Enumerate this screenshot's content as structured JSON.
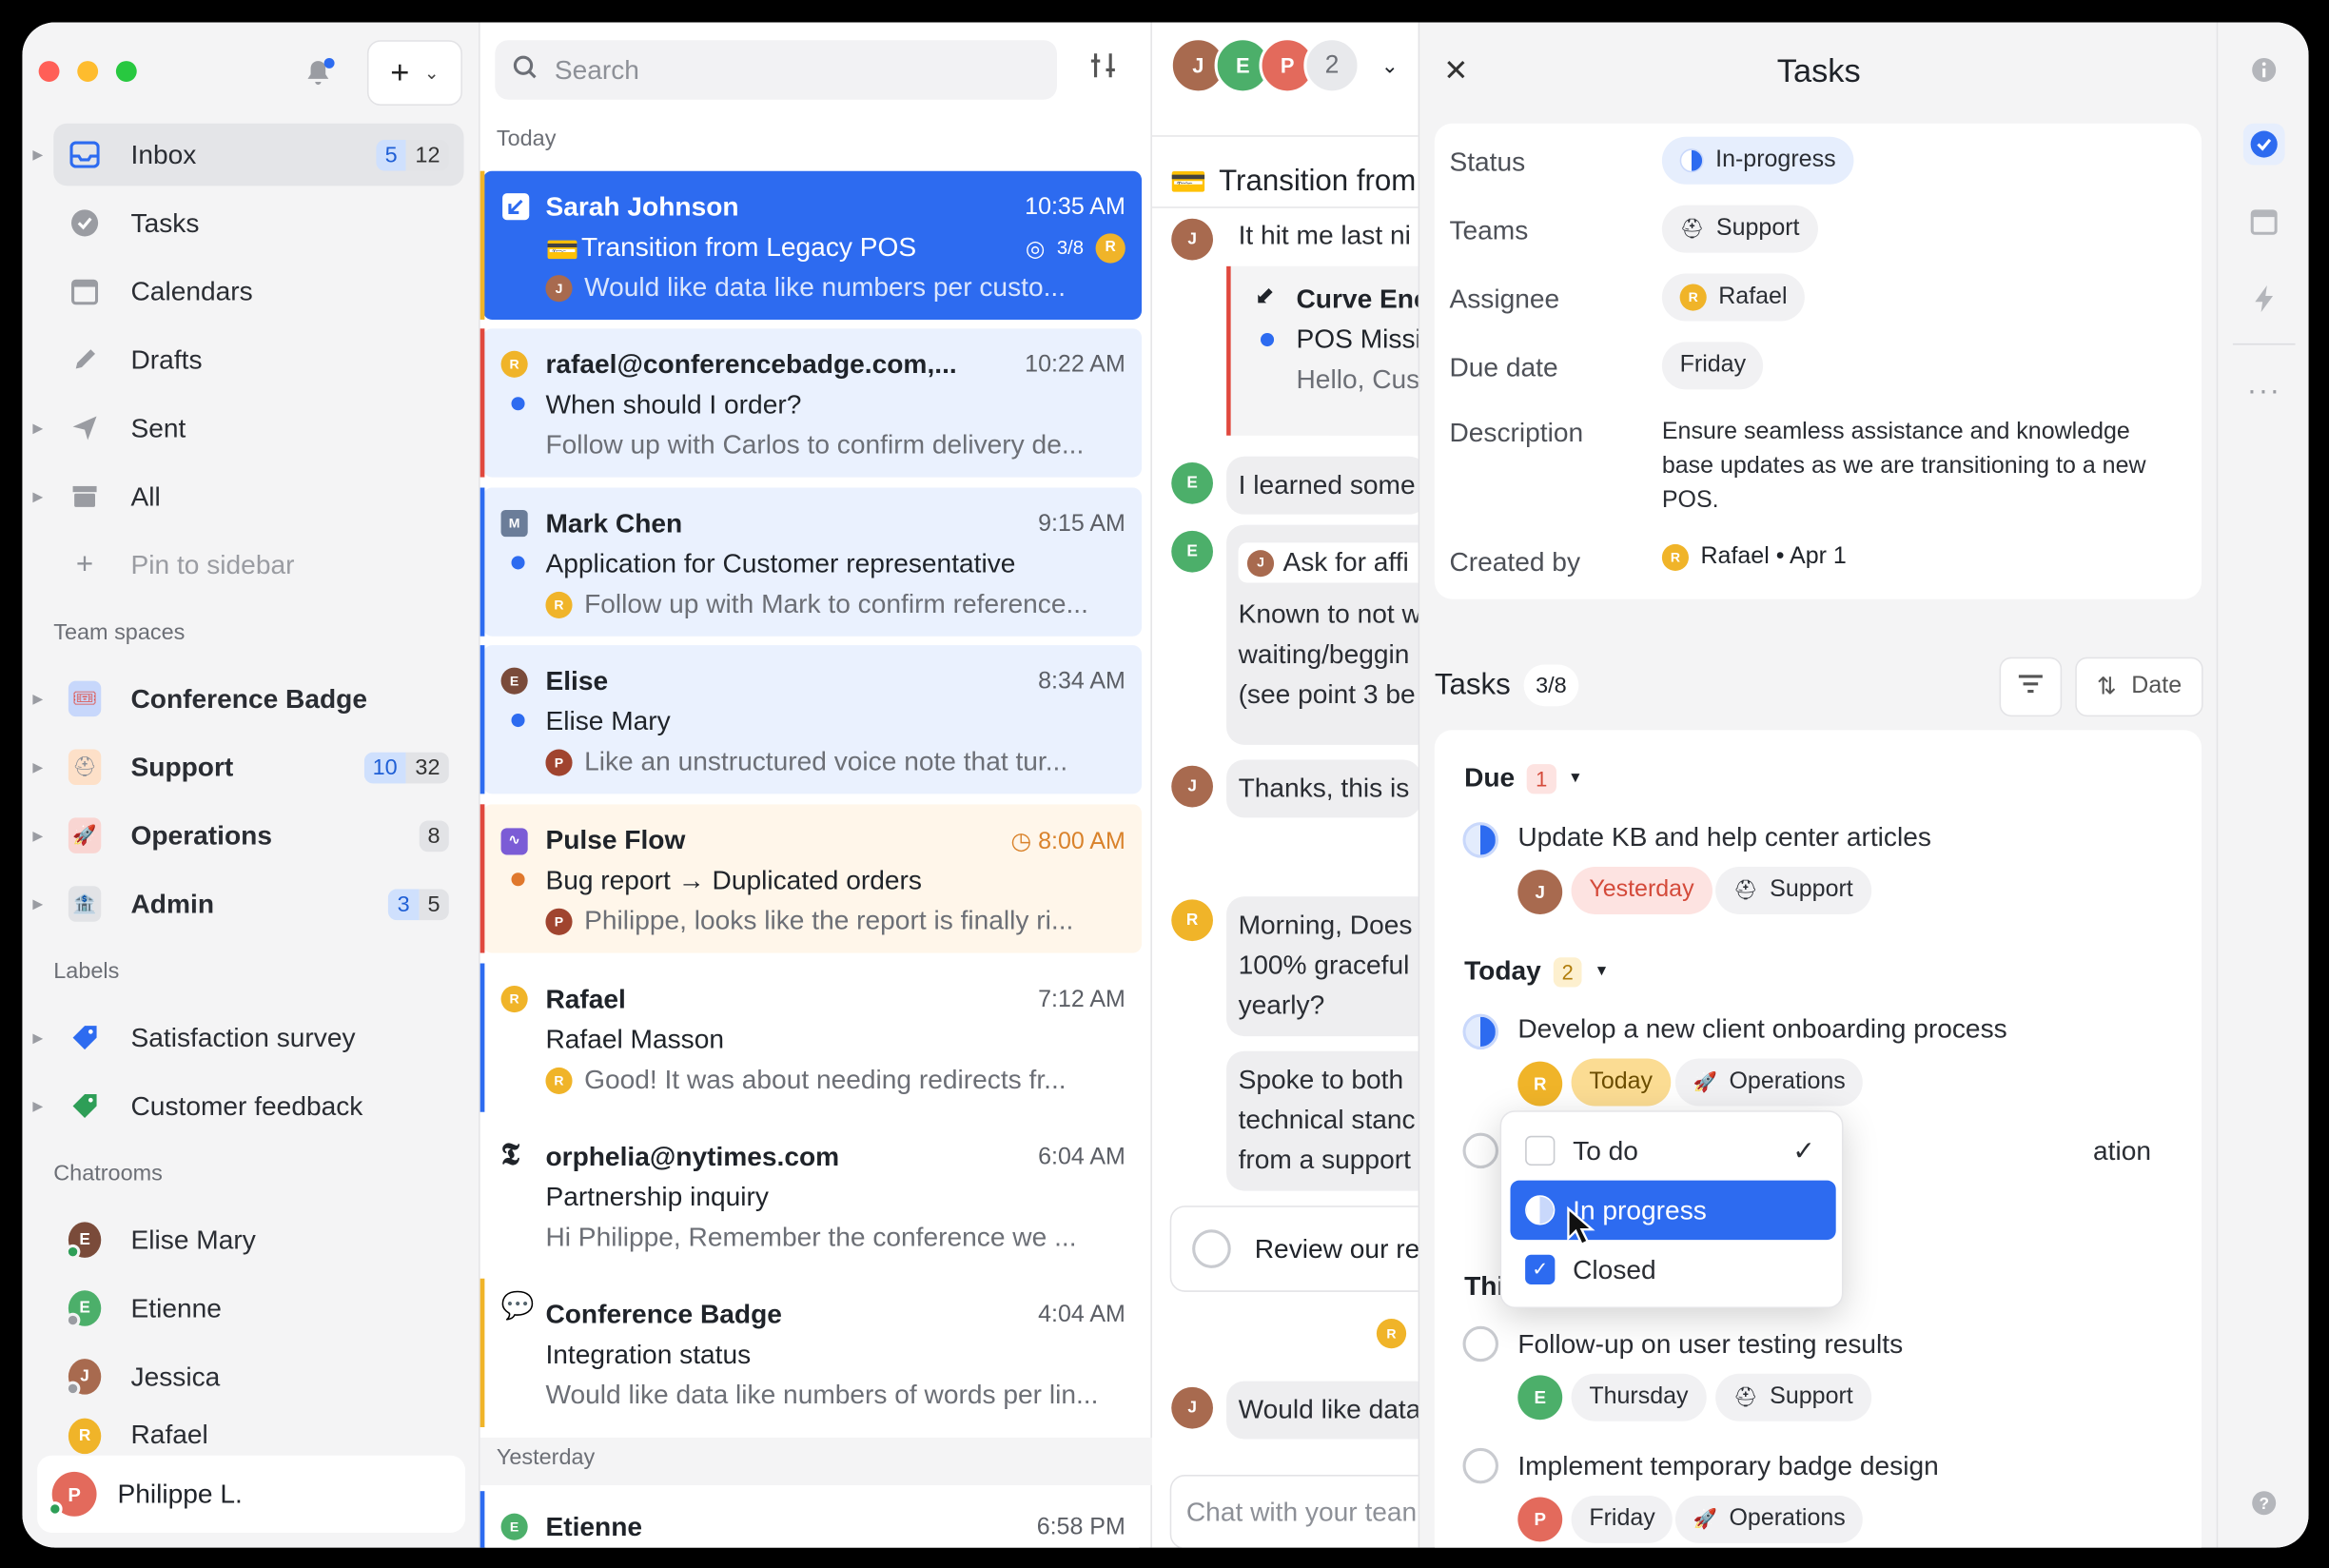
{
  "colors": {
    "accent": "#2d6bf0",
    "selected_bg": "#2d6bf0",
    "unread_dot": "#2d6bf0",
    "urgent_bar": "#e0483e",
    "warm_bg": "#fff6ea",
    "late_text": "#d44a3a"
  },
  "sidebar": {
    "nav": [
      {
        "label": "Inbox",
        "icon": "inbox-icon",
        "counts": [
          "5",
          "12"
        ]
      },
      {
        "label": "Tasks",
        "icon": "check-circle-icon"
      },
      {
        "label": "Calendars",
        "icon": "calendar-icon"
      },
      {
        "label": "Drafts",
        "icon": "pencil-icon"
      },
      {
        "label": "Sent",
        "icon": "send-icon"
      },
      {
        "label": "All",
        "icon": "archive-icon"
      }
    ],
    "pin_label": "Pin to sidebar",
    "team_spaces_label": "Team spaces",
    "teams": [
      {
        "label": "Conference Badge",
        "icon": "badge-icon"
      },
      {
        "label": "Support",
        "icon": "helmet-icon",
        "counts": [
          "10",
          "32"
        ]
      },
      {
        "label": "Operations",
        "icon": "rocket-icon",
        "counts": [
          "8"
        ]
      },
      {
        "label": "Admin",
        "icon": "building-icon",
        "counts": [
          "3",
          "5"
        ]
      }
    ],
    "labels_label": "Labels",
    "labels": [
      {
        "label": "Satisfaction survey"
      },
      {
        "label": "Customer feedback"
      }
    ],
    "chatrooms_label": "Chatrooms",
    "chatrooms": [
      {
        "label": "Elise Mary"
      },
      {
        "label": "Etienne"
      },
      {
        "label": "Jessica"
      },
      {
        "label": "Rafael"
      }
    ],
    "me": "Philippe L."
  },
  "search": {
    "placeholder": "Search"
  },
  "list": {
    "today_label": "Today",
    "yesterday_label": "Yesterday",
    "messages": [
      {
        "from": "Sarah Johnson",
        "time": "10:35 AM",
        "subject": "Transition from Legacy POS",
        "preview": "Would like data like numbers per custo...",
        "progress": "3/8"
      },
      {
        "from": "rafael@conferencebadge.com,...",
        "time": "10:22 AM",
        "subject": "When should I order?",
        "preview": "Follow up with Carlos to confirm delivery de..."
      },
      {
        "from": "Mark Chen",
        "time": "9:15 AM",
        "subject": "Application for Customer representative",
        "preview": "Follow up with Mark to confirm reference..."
      },
      {
        "from": "Elise",
        "time": "8:34 AM",
        "subject": "Elise Mary",
        "preview": "Like an unstructured voice note that tur..."
      },
      {
        "from": "Pulse Flow",
        "time": "8:00 AM",
        "subject": "Bug report → Duplicated orders",
        "preview": "Philippe, looks like the report is finally ri..."
      },
      {
        "from": "Rafael",
        "time": "7:12 AM",
        "subject": "Rafael Masson",
        "preview": "Good! It was about needing redirects fr..."
      },
      {
        "from": "orphelia@nytimes.com",
        "time": "6:04 AM",
        "subject": "Partnership inquiry",
        "preview": "Hi Philippe, Remember the conference we ..."
      },
      {
        "from": "Conference Badge",
        "time": "4:04 AM",
        "subject": "Integration status",
        "preview": "Would like data like numbers of words per lin..."
      },
      {
        "from": "Etienne",
        "time": "6:58 PM"
      }
    ]
  },
  "chat": {
    "participants_extra": "2",
    "title": "Transition from",
    "lines": [
      "It hit me last ni",
      "Curve Enc",
      "POS Missi",
      "Hello, Cus",
      "I learned some",
      "Ask for affi",
      "Known to not w",
      "waiting/beggin",
      "(see point 3 be",
      "Thanks, this is",
      "Morning, Does",
      "100% graceful",
      "yearly?",
      "Spoke to both",
      "technical stanc",
      "from a support",
      "Review our re",
      "Would like data"
    ],
    "input_placeholder": "Chat with your tean"
  },
  "tasks_panel": {
    "title": "Tasks",
    "props": {
      "status_label": "Status",
      "status": "In-progress",
      "teams_label": "Teams",
      "team": "Support",
      "assignee_label": "Assignee",
      "assignee": "Rafael",
      "due_label": "Due date",
      "due": "Friday",
      "description_label": "Description",
      "description": "Ensure seamless assistance and knowledge base updates as we are transitioning to a new POS.",
      "created_label": "Created by",
      "created": "Rafael • Apr 1"
    },
    "tasks_label": "Tasks",
    "tasks_count": "3/8",
    "sort_label": "Date",
    "groups": {
      "due": {
        "label": "Due",
        "count": "1"
      },
      "today": {
        "label": "Today",
        "count": "2"
      },
      "this_week": {
        "label": "Thi"
      }
    },
    "items": [
      {
        "title": "Update KB and help center articles",
        "date": "Yesterday",
        "team": "Support"
      },
      {
        "title": "Develop a new client onboarding process",
        "date": "Today",
        "team": "Operations"
      },
      {
        "title": "ation"
      },
      {
        "title": "Follow-up on user testing results",
        "date": "Thursday",
        "team": "Support"
      },
      {
        "title": "Implement temporary badge design",
        "date": "Friday",
        "team": "Operations"
      }
    ]
  },
  "status_menu": {
    "items": [
      {
        "label": "To do",
        "checked": true
      },
      {
        "label": "In progress"
      },
      {
        "label": "Closed"
      }
    ]
  }
}
